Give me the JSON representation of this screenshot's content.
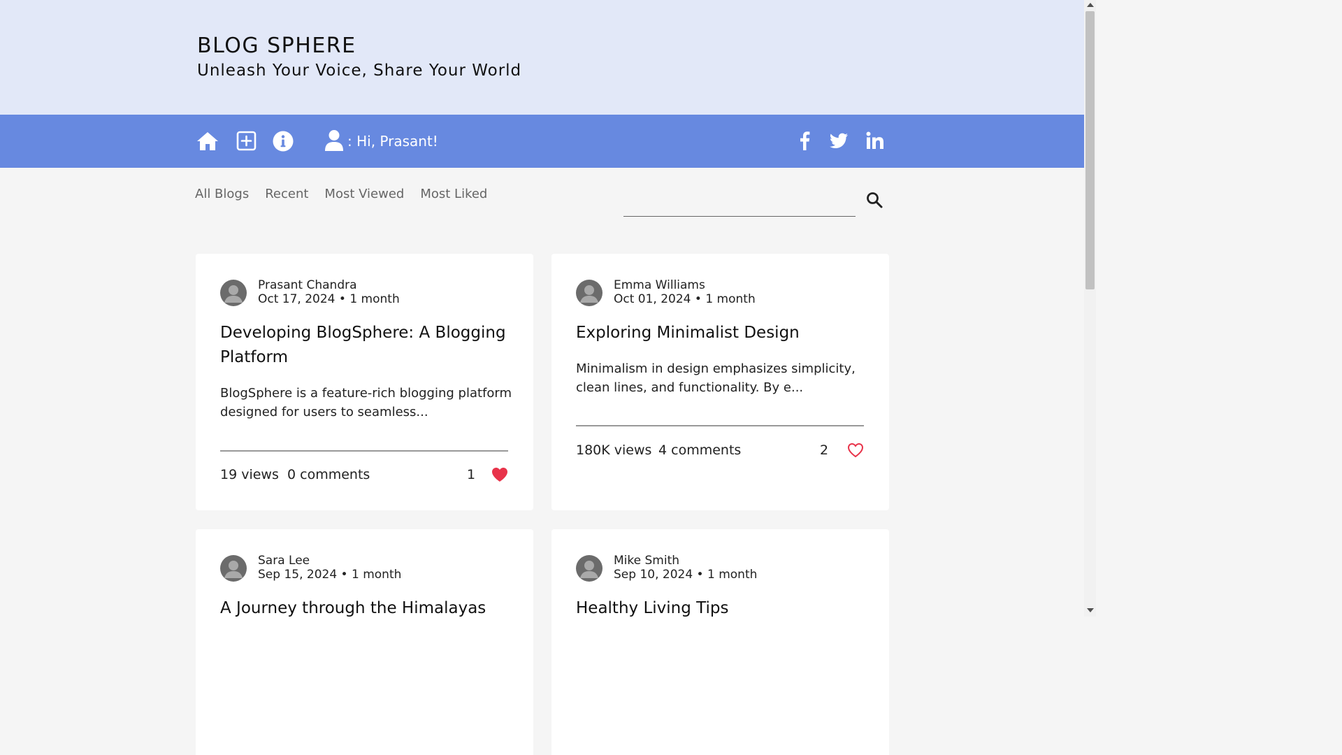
{
  "header": {
    "title": "BLOG SPHERE",
    "tagline": "Unleash Your Voice, Share Your World"
  },
  "nav": {
    "icons": [
      "home-icon",
      "add-post-icon",
      "info-icon",
      "user-icon"
    ],
    "greeting": ": Hi, Prasant!",
    "social_icons": [
      "facebook-icon",
      "twitter-icon",
      "linkedin-icon"
    ]
  },
  "filters": {
    "tabs": [
      "All Blogs",
      "Recent",
      "Most Viewed",
      "Most Liked"
    ]
  },
  "search": {
    "value": "",
    "placeholder": ""
  },
  "colors": {
    "header_bg": "#e2e8f8",
    "navbar_bg": "#6789e0",
    "like_red": "#e8334a"
  },
  "posts": [
    {
      "author": "Prasant Chandra",
      "meta": "Oct 17, 2024 • 1 month",
      "title": "Developing BlogSphere: A Blogging Platform",
      "excerpt": "BlogSphere is a feature-rich blogging platform designed for users to seamless...",
      "views": "19 views",
      "comments": "0 comments",
      "likes": "1",
      "liked": true
    },
    {
      "author": "Emma Williams",
      "meta": "Oct 01, 2024 • 1 month",
      "title": "Exploring Minimalist Design",
      "excerpt": "Minimalism in design emphasizes simplicity, clean lines, and functionality. By e...",
      "views": "180K views",
      "comments": "4 comments",
      "likes": "2",
      "liked": false
    },
    {
      "author": "Sara Lee",
      "meta": "Sep 15, 2024 • 1 month",
      "title": "A Journey through the Himalayas"
    },
    {
      "author": "Mike Smith",
      "meta": "Sep 10, 2024 • 1 month",
      "title": "Healthy Living Tips"
    }
  ]
}
